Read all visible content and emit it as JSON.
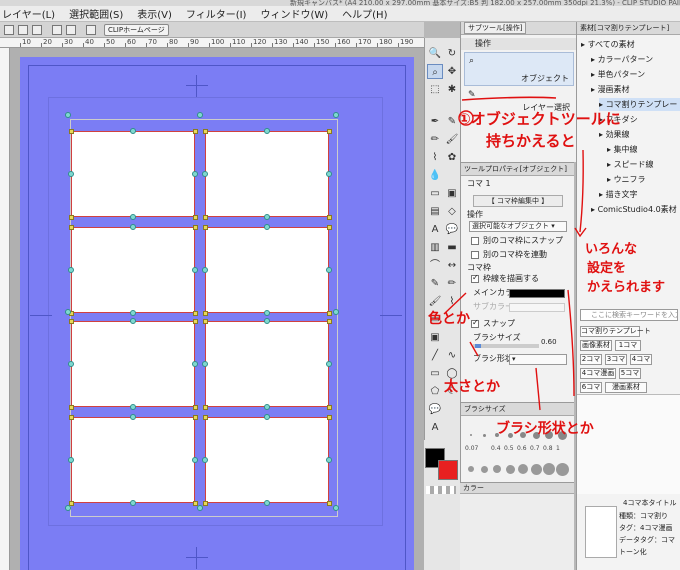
{
  "window": {
    "title": "新規キャンバス* (A4 210.00 x 297.00mm 基本サイズ:B5 判 182.00 x 257.00mm 350dpi 21.3%) - CLIP STUDIO PAINT EX"
  },
  "menu": [
    "レイヤー(L)",
    "選択範囲(S)",
    "表示(V)",
    "フィルター(I)",
    "ウィンドウ(W)",
    "ヘルプ(H)"
  ],
  "tabstrip": {
    "home_label": "CLIPホームページ"
  },
  "ruler": {
    "labels": [
      "10",
      "20",
      "30",
      "40",
      "50",
      "60",
      "70",
      "80",
      "90",
      "100",
      "110",
      "120",
      "130",
      "140",
      "150",
      "160",
      "170",
      "180",
      "190"
    ]
  },
  "subtool": {
    "header": "サブツール[操作]",
    "group_label": "操作",
    "items": [
      "オブジェクト",
      "レイヤー選択"
    ]
  },
  "toolprop": {
    "header": "ツールプロパティ[オブジェクト]",
    "frame_label": "コマ 1",
    "editing_label": "【 コマ枠編集中 】",
    "operation_label": "操作",
    "operation_value": "選択可能なオブジェクト",
    "option1": "別のコマ枠にスナップ",
    "option2": "別のコマ枠を連動",
    "frame_section": "コマ枠",
    "draw_border": "枠線を描画する",
    "main_color": "メインカラー",
    "sub_color": "サブカラー",
    "snap": "スナップ",
    "brush_size_label": "ブラシサイズ",
    "brush_size_value": "0.60",
    "brush_shape_label": "ブラシ形状",
    "main_color_value": "#000000"
  },
  "brushsize": {
    "header": "ブラシサイズ",
    "sizes": [
      "0.07",
      "",
      "0.4",
      "0.5",
      "0.6",
      "0.7",
      "0.8",
      "1"
    ]
  },
  "colorbar": {
    "tab_label": "カラー"
  },
  "colors": {
    "foreground": "#000000",
    "background": "#e82020",
    "paper": "#7b7df4"
  },
  "material": {
    "header": "素材[コマ割りテンプレート]",
    "tree": [
      "すべての素材",
      "カラーパターン",
      "単色パターン",
      "漫画素材",
      "コマ割りテンプレート",
      "フキダシ",
      "効果線",
      "集中線",
      "スピード線",
      "ウニフラ",
      "描き文字",
      "ComicStudio4.0素材"
    ],
    "search_placeholder": "ここに検索キーワードを入力",
    "tag_buttons": [
      "コマ割りテンプレート",
      "画像素材",
      "1コマ",
      "2コマ",
      "3コマ",
      "4コマ",
      "4コマ漫画",
      "5コマ",
      "6コマ",
      "漫画素材"
    ],
    "detail_title": "4コマ本タイトル",
    "detail_rows": [
      "種類：コマ割り",
      "タグ：4コマ漫画",
      "データタグ：コマ",
      "トーン化"
    ]
  },
  "annotations": {
    "note1a": "①オブジェクトツールに",
    "note1b": "持ちかえると",
    "note2a": "いろんな",
    "note2b": "設定を",
    "note2c": "かえられます",
    "note3": "色とか",
    "note4": "太さとか",
    "note5": "ブラシ形状とか"
  }
}
